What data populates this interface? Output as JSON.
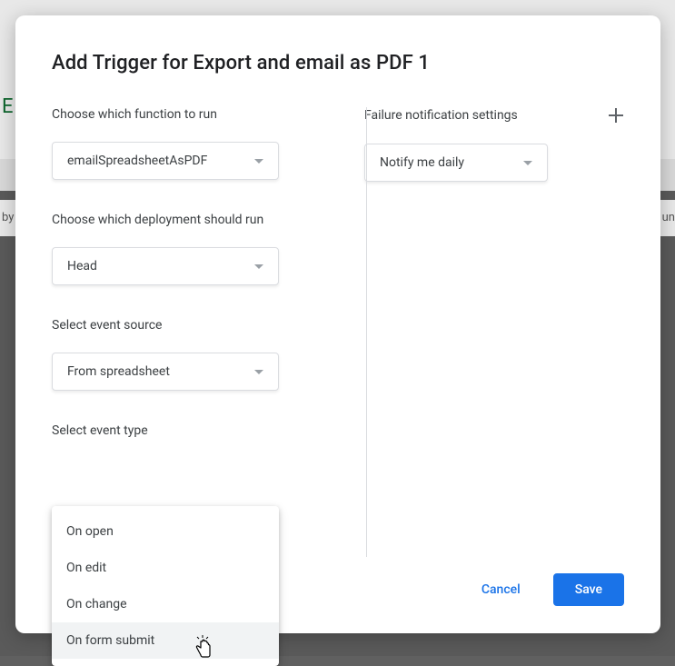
{
  "dialog": {
    "title": "Add Trigger for Export and email as PDF 1",
    "left": {
      "function_label": "Choose which function to run",
      "function_value": "emailSpreadsheetAsPDF",
      "deployment_label": "Choose which deployment should run",
      "deployment_value": "Head",
      "source_label": "Select event source",
      "source_value": "From spreadsheet",
      "event_type_label": "Select event type",
      "event_type_options": [
        "On open",
        "On edit",
        "On change",
        "On form submit"
      ]
    },
    "right": {
      "failure_label": "Failure notification settings",
      "failure_value": "Notify me daily"
    },
    "actions": {
      "cancel": "Cancel",
      "save": "Save"
    }
  },
  "background": {
    "left_char": "E",
    "by": "by",
    "unc": "un"
  }
}
